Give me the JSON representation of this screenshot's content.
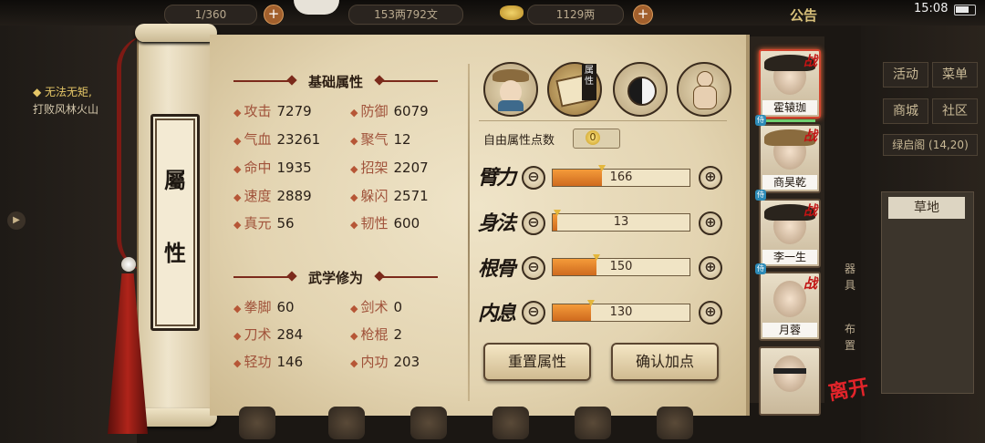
{
  "topbar": {
    "energy": "1/360",
    "copper": "153两792文",
    "gold": "1129两",
    "announcement": "公告",
    "time": "15:08"
  },
  "quest": {
    "title": "无法无矩,",
    "detail": "打败风林火山"
  },
  "scroll": {
    "title_char_1": "屬",
    "title_char_2": "性"
  },
  "basic": {
    "section_title": "基础属性",
    "stats": [
      {
        "label": "攻击",
        "value": "7279"
      },
      {
        "label": "防御",
        "value": "6079"
      },
      {
        "label": "气血",
        "value": "23261"
      },
      {
        "label": "聚气",
        "value": "12"
      },
      {
        "label": "命中",
        "value": "1935"
      },
      {
        "label": "招架",
        "value": "2207"
      },
      {
        "label": "速度",
        "value": "2889"
      },
      {
        "label": "躲闪",
        "value": "2571"
      },
      {
        "label": "真元",
        "value": "56"
      },
      {
        "label": "韧性",
        "value": "600"
      }
    ]
  },
  "martial": {
    "section_title": "武学修为",
    "stats": [
      {
        "label": "拳脚",
        "value": "60"
      },
      {
        "label": "剑术",
        "value": "0"
      },
      {
        "label": "刀术",
        "value": "284"
      },
      {
        "label": "枪棍",
        "value": "2"
      },
      {
        "label": "轻功",
        "value": "146"
      },
      {
        "label": "内功",
        "value": "203"
      }
    ]
  },
  "tabs": {
    "active_tag": "属性",
    "icons": [
      "character-portrait-icon",
      "attribute-scroll-icon",
      "bagua-icon",
      "meridian-body-icon"
    ]
  },
  "allocation": {
    "free_points_label": "自由属性点数",
    "free_points": "0",
    "attributes": [
      {
        "name": "臂力",
        "value": "166",
        "fill": 0.36
      },
      {
        "name": "身法",
        "value": "13",
        "fill": 0.03
      },
      {
        "name": "根骨",
        "value": "150",
        "fill": 0.32
      },
      {
        "name": "内息",
        "value": "130",
        "fill": 0.28
      }
    ],
    "minus_symbol": "⊖",
    "plus_symbol": "⊕",
    "reset_label": "重置属性",
    "confirm_label": "确认加点"
  },
  "party": [
    {
      "name": "霍辕珈",
      "battle": "战"
    },
    {
      "name": "商昊乾",
      "battle": "战"
    },
    {
      "name": "李一生",
      "battle": "战"
    },
    {
      "name": "月蓉",
      "battle": "战"
    }
  ],
  "party_side": {
    "weapon_label": "器具",
    "layout_label": "布置",
    "leave_label": "离开",
    "attendant_tag": "侍"
  },
  "right_menu": {
    "activity": "活动",
    "menu": "菜单",
    "shop": "商城",
    "community": "社区",
    "location": "绿启阁 (14,20)",
    "terrain": "草地"
  },
  "colors": {
    "accent_orange": "#e07a2a",
    "title_red": "#7b2a1b",
    "battle_red": "#c11414"
  }
}
